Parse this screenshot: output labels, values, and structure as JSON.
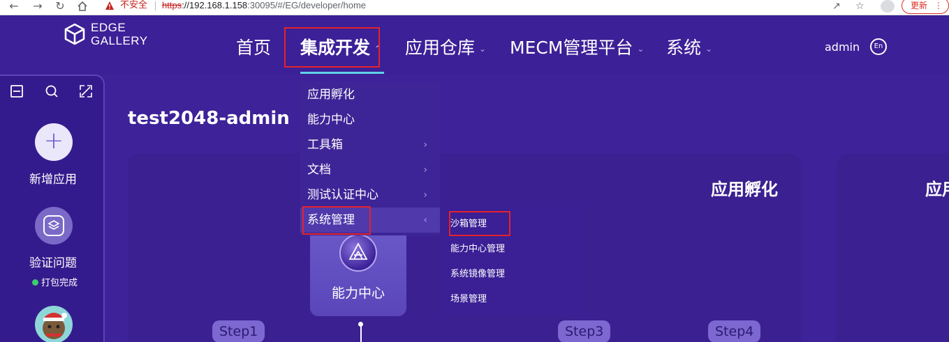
{
  "browser": {
    "back_icon": "arrow-left",
    "forward_icon": "arrow-right",
    "reload_icon": "reload",
    "home_icon": "home",
    "security_label": "不安全",
    "url_protocol": "https",
    "url_host": "://192.168.1.158",
    "url_rest": ":30095/#/EG/developer/home",
    "update_label": "更新"
  },
  "header": {
    "logo_line1": "EDGE",
    "logo_line2": "GALLERY",
    "nav": [
      {
        "label": "首页",
        "has_chevron": false
      },
      {
        "label": "集成开发",
        "has_chevron": true,
        "active": true
      },
      {
        "label": "应用仓库",
        "has_chevron": true
      },
      {
        "label": "MECM管理平台",
        "has_chevron": true
      },
      {
        "label": "系统",
        "has_chevron": true
      }
    ],
    "user": "admin",
    "lang": "En"
  },
  "side": {
    "add_label": "新增应用",
    "verify_label": "验证问题",
    "status_label": "打包完成",
    "status_color": "#3ecf6b"
  },
  "main": {
    "project_title": "test2048-admin",
    "card_title": "应用孵化",
    "card_right_title": "应用",
    "capability_label": "能力中心",
    "steps": [
      "Step1",
      "Step3",
      "Step4"
    ]
  },
  "dropdown": {
    "items": [
      {
        "label": "应用孵化",
        "submenu": false
      },
      {
        "label": "能力中心",
        "submenu": false
      },
      {
        "label": "工具箱",
        "submenu": true
      },
      {
        "label": "文档",
        "submenu": true
      },
      {
        "label": "测试认证中心",
        "submenu": true
      },
      {
        "label": "系统管理",
        "submenu": true,
        "open": true
      }
    ],
    "system_submenu": [
      "沙箱管理",
      "能力中心管理",
      "系统镜像管理",
      "场景管理"
    ]
  },
  "colors": {
    "background": "#3d2299",
    "accent_underline": "#5fd3e6",
    "highlight_box": "#e5222a"
  }
}
